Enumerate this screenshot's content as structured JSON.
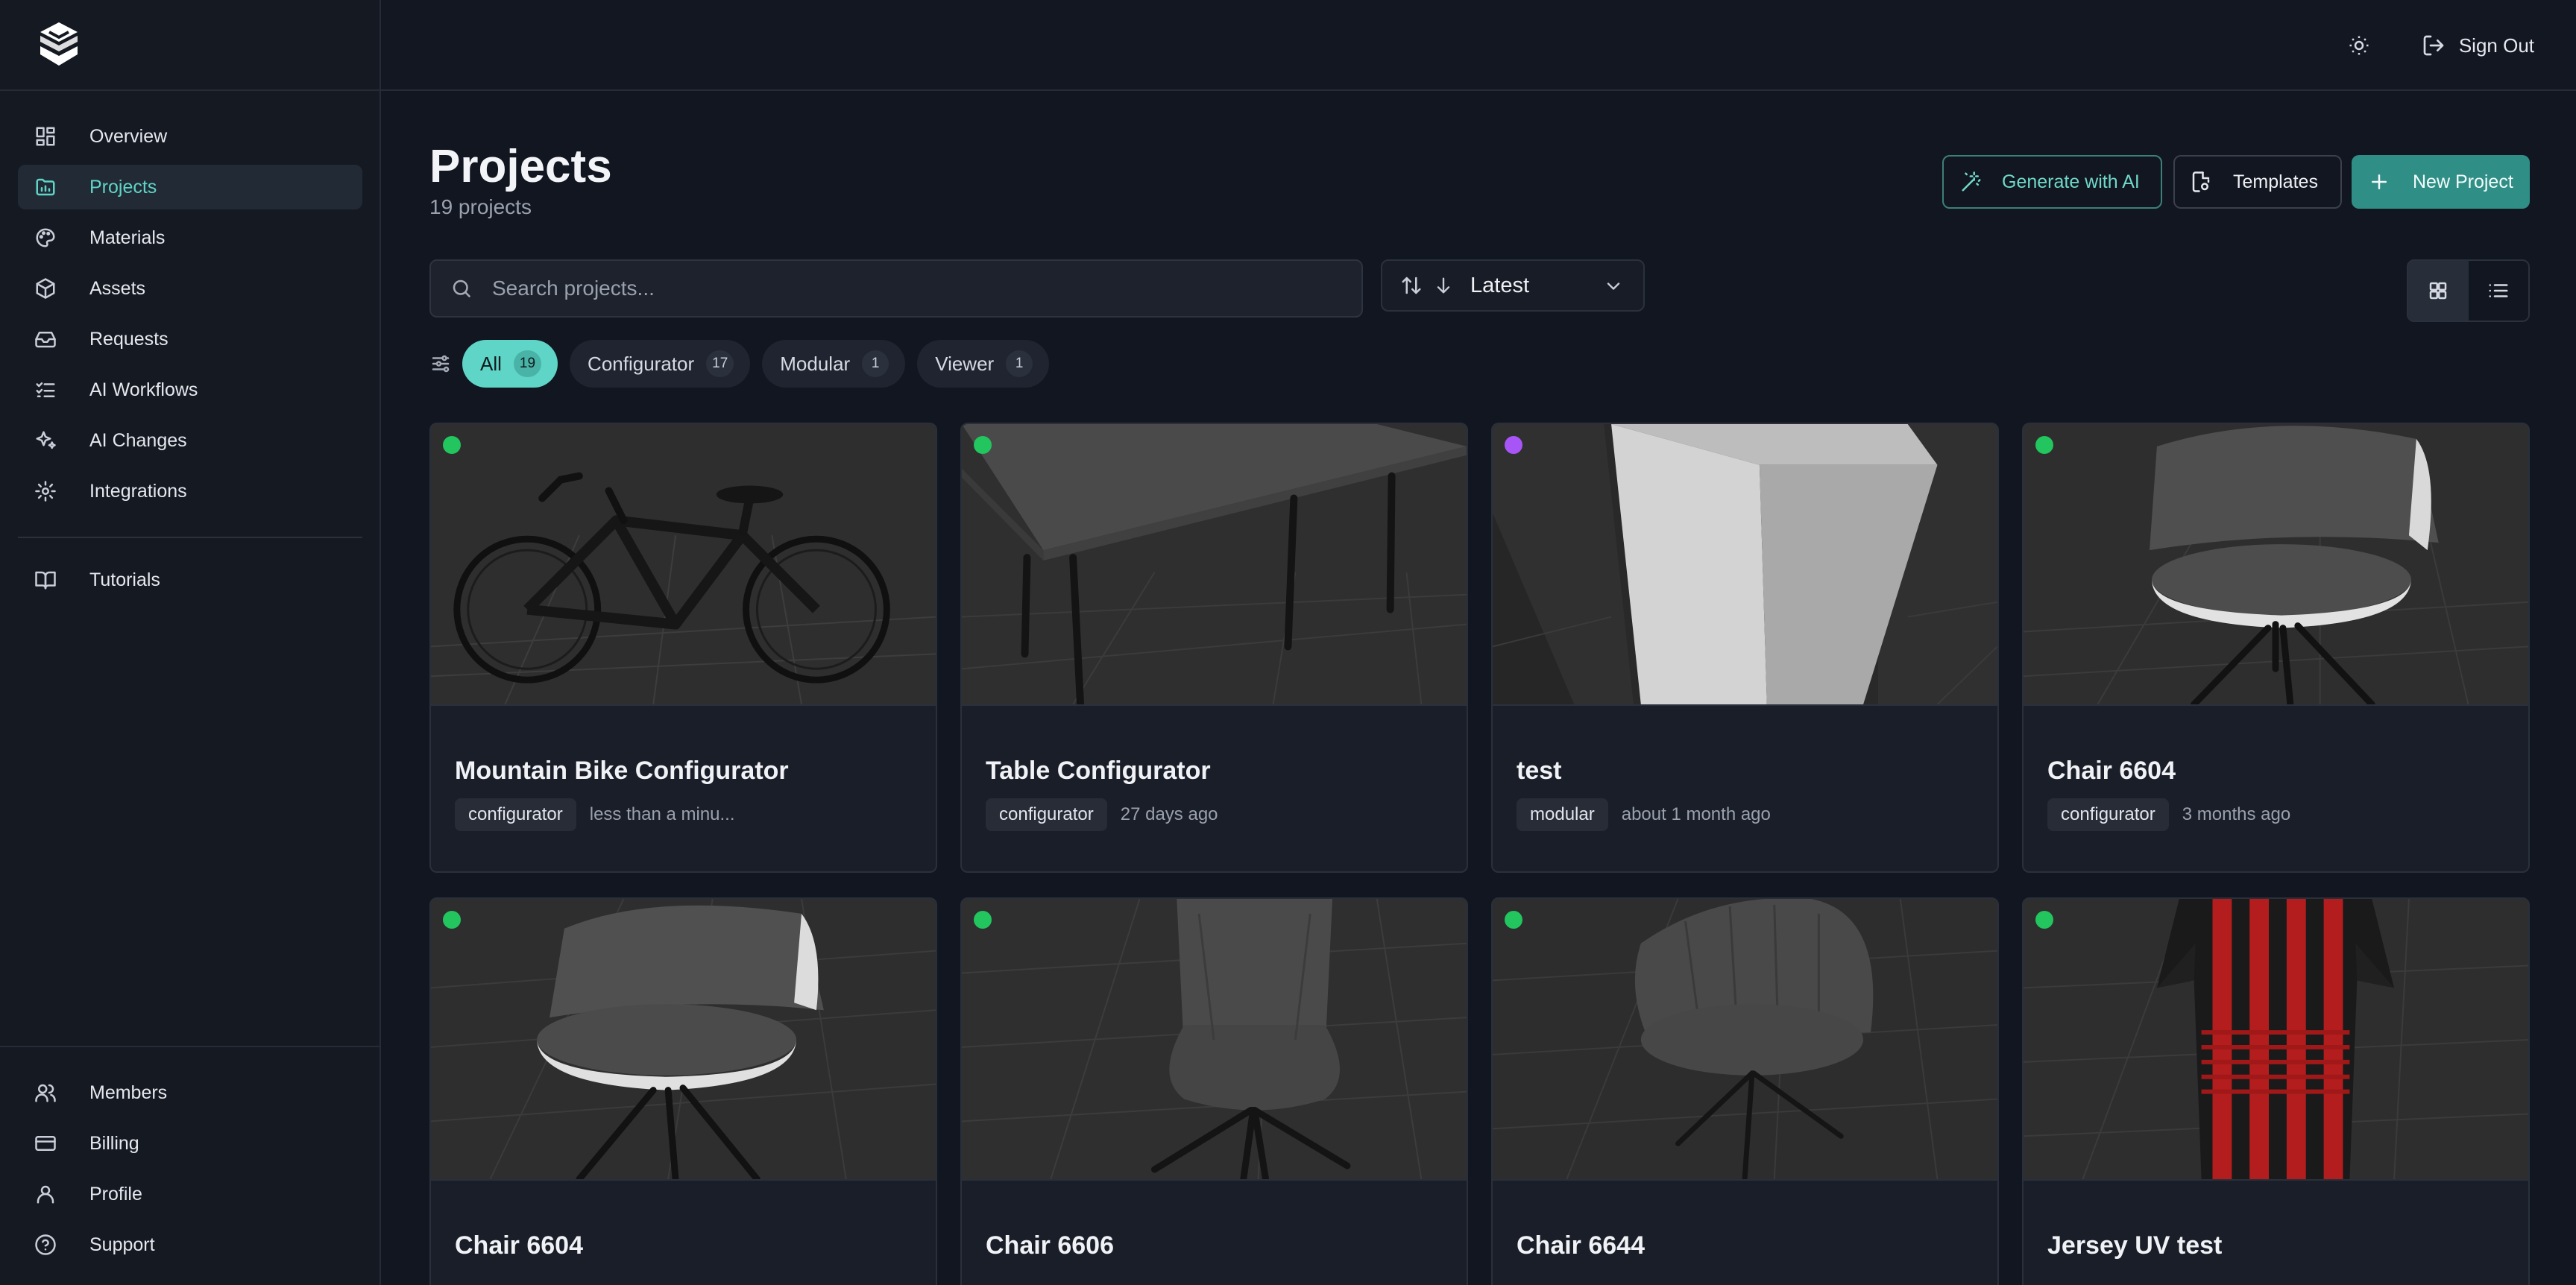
{
  "sidebar": {
    "top_items": [
      {
        "label": "Overview",
        "icon": "layout-dashboard-icon",
        "active": false
      },
      {
        "label": "Projects",
        "icon": "folder-chart-icon",
        "active": true
      },
      {
        "label": "Materials",
        "icon": "palette-icon",
        "active": false
      },
      {
        "label": "Assets",
        "icon": "box-icon",
        "active": false
      },
      {
        "label": "Requests",
        "icon": "inbox-icon",
        "active": false
      },
      {
        "label": "AI Workflows",
        "icon": "list-checks-icon",
        "active": false
      },
      {
        "label": "AI Changes",
        "icon": "sparkles-icon",
        "active": false
      },
      {
        "label": "Integrations",
        "icon": "gear-icon",
        "active": false
      }
    ],
    "secondary_items": [
      {
        "label": "Tutorials",
        "icon": "book-icon"
      }
    ],
    "bottom_items": [
      {
        "label": "Members",
        "icon": "users-icon"
      },
      {
        "label": "Billing",
        "icon": "credit-card-icon"
      },
      {
        "label": "Profile",
        "icon": "user-icon"
      },
      {
        "label": "Support",
        "icon": "help-circle-icon"
      }
    ]
  },
  "topbar": {
    "theme_icon": "sun-icon",
    "signout_label": "Sign Out"
  },
  "header": {
    "title": "Projects",
    "subtitle": "19 projects",
    "generate_label": "Generate with AI",
    "templates_label": "Templates",
    "new_project_label": "New Project"
  },
  "search": {
    "placeholder": "Search projects...",
    "value": ""
  },
  "sort": {
    "selected": "Latest"
  },
  "filters": [
    {
      "label": "All",
      "count": "19",
      "active": true
    },
    {
      "label": "Configurator",
      "count": "17",
      "active": false
    },
    {
      "label": "Modular",
      "count": "1",
      "active": false
    },
    {
      "label": "Viewer",
      "count": "1",
      "active": false
    }
  ],
  "colors": {
    "accent": "#5ed5c6",
    "status_green": "#22c55e",
    "status_purple": "#a855f7"
  },
  "projects": [
    {
      "title": "Mountain Bike Configurator",
      "tag": "configurator",
      "time": "less than a minu...",
      "status": "green",
      "preview": "bike"
    },
    {
      "title": "Table Configurator",
      "tag": "configurator",
      "time": "27 days ago",
      "status": "green",
      "preview": "table"
    },
    {
      "title": "test",
      "tag": "modular",
      "time": "about 1 month ago",
      "status": "purple",
      "preview": "box"
    },
    {
      "title": "Chair 6604",
      "tag": "configurator",
      "time": "3 months ago",
      "status": "green",
      "preview": "chair-white"
    },
    {
      "title": "Chair 6604",
      "tag": "",
      "time": "",
      "status": "green",
      "preview": "chair-white"
    },
    {
      "title": "Chair 6606",
      "tag": "",
      "time": "",
      "status": "green",
      "preview": "chair-grey"
    },
    {
      "title": "Chair 6644",
      "tag": "",
      "time": "",
      "status": "green",
      "preview": "chair-shell"
    },
    {
      "title": "Jersey UV test",
      "tag": "",
      "time": "",
      "status": "green",
      "preview": "jersey"
    }
  ]
}
